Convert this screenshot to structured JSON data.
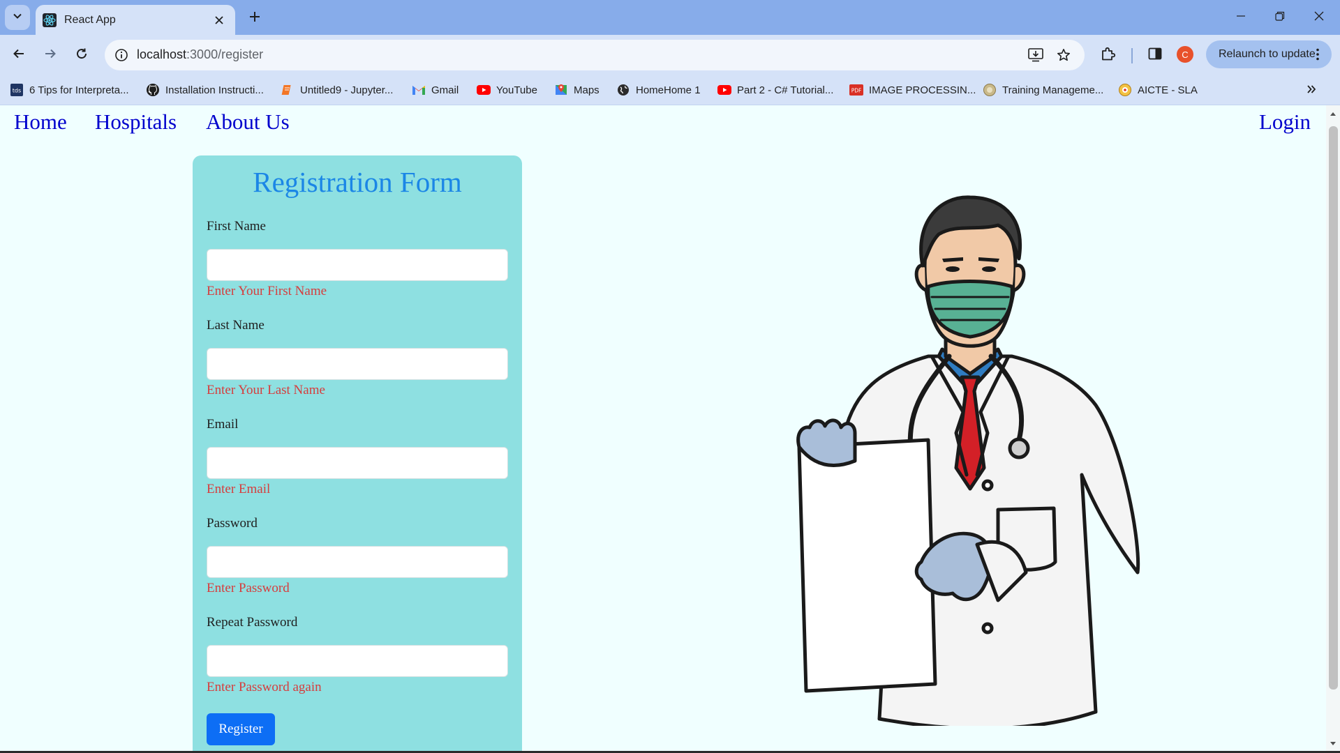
{
  "browser": {
    "tab": {
      "title": "React App",
      "favicon": "react-icon"
    },
    "omnibox": {
      "host": "localhost",
      "path": ":3000/register"
    },
    "profile_initial": "C",
    "relaunch_label": "Relaunch to update",
    "bookmarks": [
      {
        "label": "6 Tips for Interpreta...",
        "icon": "tds-icon"
      },
      {
        "label": "Installation Instructi...",
        "icon": "github-icon"
      },
      {
        "label": "Untitled9 - Jupyter...",
        "icon": "jupyter-icon"
      },
      {
        "label": "Gmail",
        "icon": "gmail-icon"
      },
      {
        "label": "YouTube",
        "icon": "youtube-icon"
      },
      {
        "label": "Maps",
        "icon": "maps-icon"
      },
      {
        "label": "HomeHome 1",
        "icon": "globe-icon"
      },
      {
        "label": "Part 2 - C# Tutorial...",
        "icon": "youtube-icon"
      },
      {
        "label": "IMAGE PROCESSIN...",
        "icon": "pdf-icon"
      },
      {
        "label": "Training Manageme...",
        "icon": "training-icon"
      },
      {
        "label": "AICTE - SLA",
        "icon": "aicte-icon"
      }
    ]
  },
  "page": {
    "nav": {
      "home": "Home",
      "hospitals": "Hospitals",
      "about": "About Us",
      "login": "Login"
    },
    "form": {
      "title": "Registration Form",
      "fields": [
        {
          "label": "First Name",
          "value": "",
          "error": "Enter Your First Name"
        },
        {
          "label": "Last Name",
          "value": "",
          "error": "Enter Your Last Name"
        },
        {
          "label": "Email",
          "value": "",
          "error": "Enter Email"
        },
        {
          "label": "Password",
          "value": "",
          "error": "Enter Password"
        },
        {
          "label": "Repeat Password",
          "value": "",
          "error": "Enter Password again"
        }
      ],
      "submit_label": "Register"
    },
    "illustration": "doctor-with-clipboard"
  },
  "colors": {
    "tabstrip": "#87acea",
    "toolbar": "#d5e2f8",
    "page_bg": "#f0ffff",
    "card_bg": "#8ee0e1",
    "title": "#1b86e6",
    "nav_link": "#0000cd",
    "error": "#d63d3d",
    "button": "#0d6ef5"
  }
}
